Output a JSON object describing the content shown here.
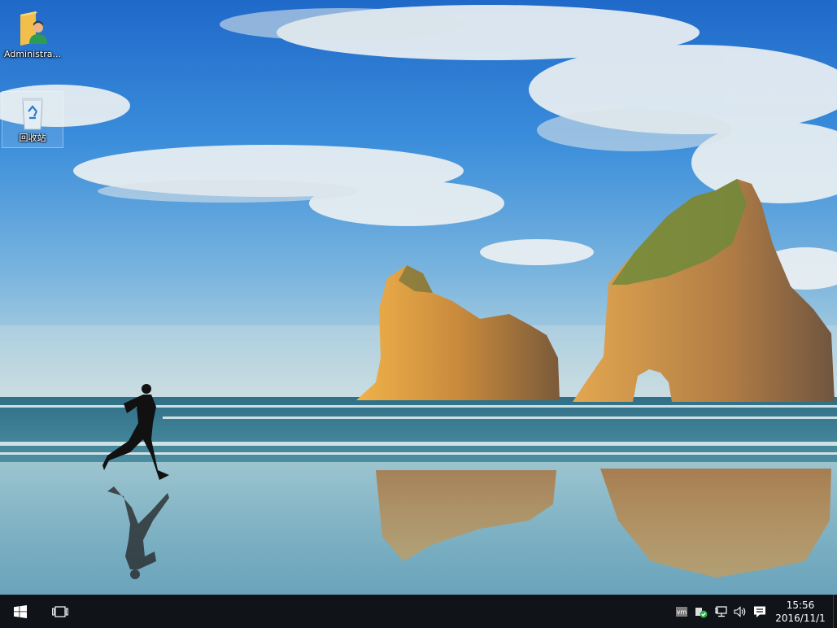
{
  "desktop": {
    "icons": [
      {
        "label": "Administra...",
        "icon": "user-folder-icon"
      },
      {
        "label": "回收站",
        "icon": "recycle-bin-icon"
      }
    ]
  },
  "taskbar": {
    "start_icon": "windows-logo-icon",
    "taskview_icon": "task-view-icon",
    "tray": [
      {
        "icon": "vmware-tools-icon",
        "text": "vm"
      },
      {
        "icon": "security-shield-icon"
      },
      {
        "icon": "network-icon"
      },
      {
        "icon": "volume-icon"
      },
      {
        "icon": "action-center-icon"
      }
    ],
    "clock": {
      "time": "15:56",
      "date": "2016/11/1"
    }
  },
  "colors": {
    "taskbar": "#101318",
    "sky": "#2f7fd0",
    "sea": "#3f7f9a"
  }
}
